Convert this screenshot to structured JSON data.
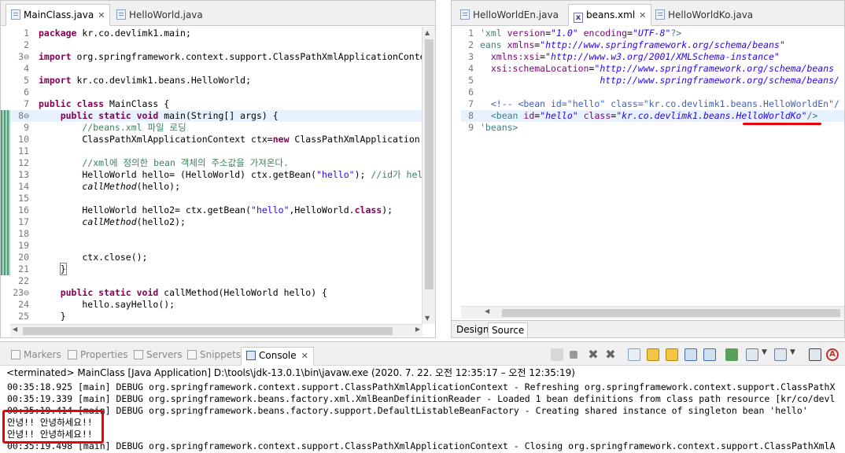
{
  "left_editor": {
    "tabs": [
      {
        "label": "MainClass.java",
        "active": true
      },
      {
        "label": "HelloWorld.java",
        "active": false
      }
    ],
    "lines": [
      {
        "n": "1",
        "t": "package kr.co.devlimk1.main;"
      },
      {
        "n": "2",
        "t": ""
      },
      {
        "n": "3⊖",
        "t": "import org.springframework.context.support.ClassPathXmlApplicationConte"
      },
      {
        "n": "4",
        "t": ""
      },
      {
        "n": "5",
        "t": "import kr.co.devlimk1.beans.HelloWorld;"
      },
      {
        "n": "6",
        "t": ""
      },
      {
        "n": "7",
        "t": "public class MainClass {"
      },
      {
        "n": "8⊖",
        "t": "    public static void main(String[] args) {"
      },
      {
        "n": "9",
        "t": "        //beans.xml 파일 로딩"
      },
      {
        "n": "10",
        "t": "        ClassPathXmlApplicationContext ctx=new ClassPathXmlApplication"
      },
      {
        "n": "11",
        "t": ""
      },
      {
        "n": "12",
        "t": "        //xml에 정의한 bean 객체의 주소값을 가져온다."
      },
      {
        "n": "13",
        "t": "        HelloWorld hello= (HelloWorld) ctx.getBean(\"hello\"); //id가 hel"
      },
      {
        "n": "14",
        "t": "        callMethod(hello);"
      },
      {
        "n": "15",
        "t": ""
      },
      {
        "n": "16",
        "t": "        HelloWorld hello2= ctx.getBean(\"hello\",HelloWorld.class);"
      },
      {
        "n": "17",
        "t": "        callMethod(hello2);"
      },
      {
        "n": "18",
        "t": ""
      },
      {
        "n": "19",
        "t": ""
      },
      {
        "n": "20",
        "t": "        ctx.close();"
      },
      {
        "n": "21",
        "t": "    }"
      },
      {
        "n": "22",
        "t": ""
      },
      {
        "n": "23⊖",
        "t": "    public static void callMethod(HelloWorld hello) {"
      },
      {
        "n": "24",
        "t": "        hello.sayHello();"
      },
      {
        "n": "25",
        "t": "    }"
      }
    ]
  },
  "right_editor": {
    "tabs": [
      {
        "label": "HelloWorldEn.java",
        "active": false
      },
      {
        "label": "beans.xml",
        "active": true
      },
      {
        "label": "HelloWorldKo.java",
        "active": false
      }
    ],
    "lines": [
      {
        "n": "1",
        "t": "'xml version=\"1.0\" encoding=\"UTF-8\"?>"
      },
      {
        "n": "2",
        "t": "eans xmlns=\"http://www.springframework.org/schema/beans\""
      },
      {
        "n": "3",
        "t": "  xmlns:xsi=\"http://www.w3.org/2001/XMLSchema-instance\""
      },
      {
        "n": "4",
        "t": "  xsi:schemaLocation=\"http://www.springframework.org/schema/beans"
      },
      {
        "n": "5",
        "t": "                      http://www.springframework.org/schema/beans/"
      },
      {
        "n": "6",
        "t": ""
      },
      {
        "n": "7",
        "t": "  <!-- <bean id=\"hello\" class=\"kr.co.devlimk1.beans.HelloWorldEn\"/"
      },
      {
        "n": "8",
        "t": "  <bean id=\"hello\" class=\"kr.co.devlimk1.beans.HelloWorldKo\"/>"
      },
      {
        "n": "9",
        "t": "'beans>"
      }
    ],
    "bottom_tabs": [
      {
        "label": "Design",
        "active": false
      },
      {
        "label": "Source",
        "active": true
      }
    ]
  },
  "console_view": {
    "tabs": [
      {
        "label": "Markers",
        "active": false
      },
      {
        "label": "Properties",
        "active": false
      },
      {
        "label": "Servers",
        "active": false
      },
      {
        "label": "Snippets",
        "active": false
      },
      {
        "label": "Console",
        "active": true
      }
    ],
    "status": "<terminated> MainClass [Java Application] D:\\tools\\jdk-13.0.1\\bin\\javaw.exe  (2020. 7. 22. 오전 12:35:17 – 오전 12:35:19)",
    "lines": [
      "00:35:18.925 [main] DEBUG org.springframework.context.support.ClassPathXmlApplicationContext - Refreshing org.springframework.context.support.ClassPathX",
      "00:35:19.339 [main] DEBUG org.springframework.beans.factory.xml.XmlBeanDefinitionReader - Loaded 1 bean definitions from class path resource [kr/co/devl",
      "00:35:19.414 [main] DEBUG org.springframework.beans.factory.support.DefaultListableBeanFactory - Creating shared instance of singleton bean 'hello'",
      "안녕!! 안녕하세요!!",
      "안녕!! 안녕하세요!!",
      "00:35:19.498 [main] DEBUG org.springframework.context.support.ClassPathXmlApplicationContext - Closing org.springframework.context.support.ClassPathXmlA"
    ]
  },
  "colors": {
    "highlight": "#e8000b",
    "keyword": "#7f0055",
    "string": "#2a00ff",
    "comment": "#3f7f5f"
  }
}
